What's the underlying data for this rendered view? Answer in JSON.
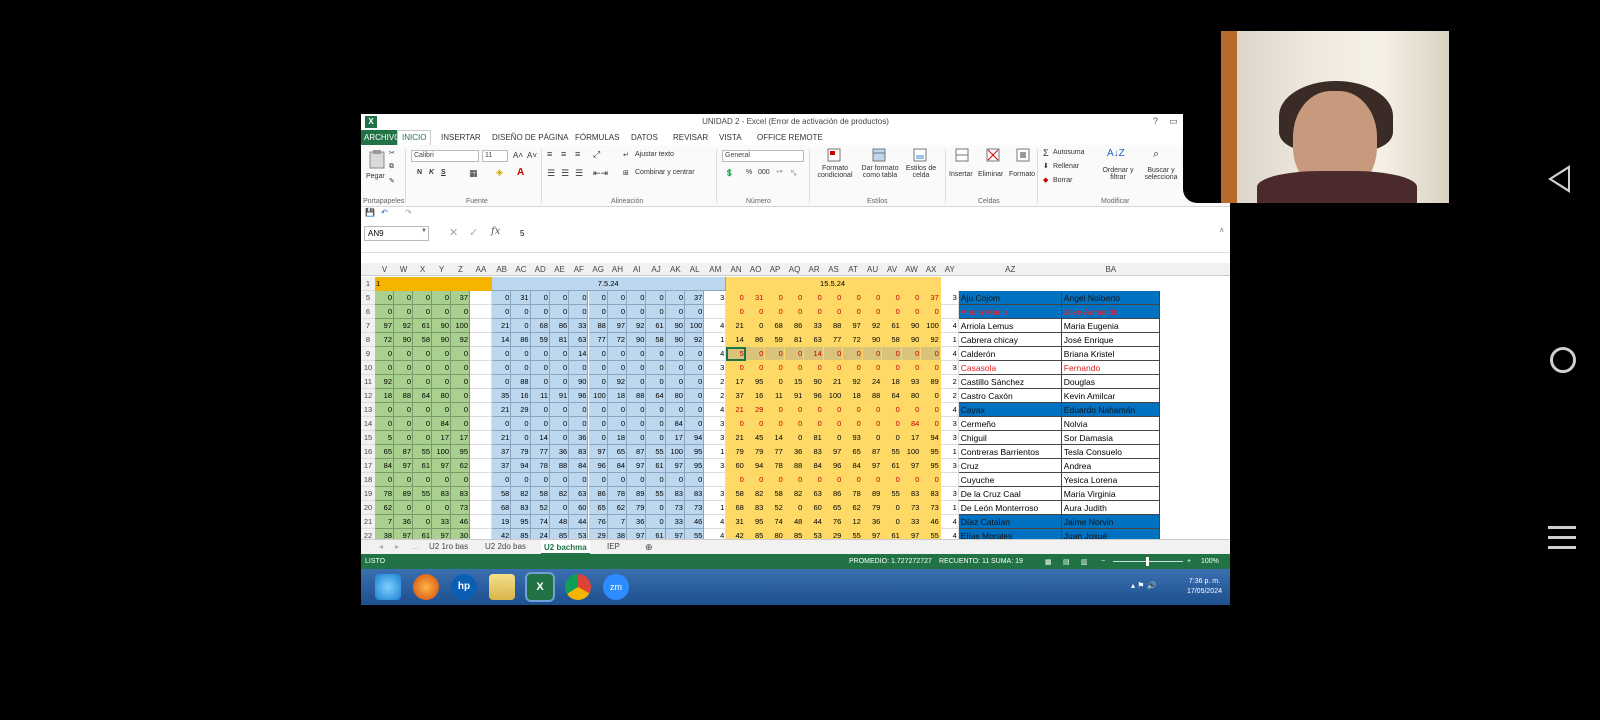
{
  "window": {
    "title": "UNIDAD 2 - Excel (Error de activación de productos)",
    "help": "?",
    "restore": "▭"
  },
  "menu": {
    "tabs": [
      "ARCHIVO",
      "INICIO",
      "INSERTAR",
      "DISEÑO DE PÁGINA",
      "FÓRMULAS",
      "DATOS",
      "REVISAR",
      "VISTA",
      "OFFICE REMOTE"
    ]
  },
  "ribbon": {
    "paste": "Pegar",
    "font_name": "Calibri",
    "font_size": "11",
    "bold": "N",
    "italic": "K",
    "underline": "S",
    "wrap_text": "Ajustar texto",
    "merge_center": "Combinar y centrar",
    "number_format": "General",
    "percent": "%",
    "thousands": "000",
    "cond_format": "Formato condicional",
    "format_table": "Dar formato como tabla",
    "cell_styles": "Estilos de celda",
    "insert": "Insertar",
    "delete": "Eliminar",
    "format": "Formato",
    "autosum": "Autosuma",
    "fill": "Rellenar",
    "clear": "Borrar",
    "sort_filter": "Ordenar y filtrar",
    "find_select": "Buscar y selecciona",
    "groups": [
      "Portapapeles",
      "Fuente",
      "Alineación",
      "Número",
      "Estilos",
      "Celdas",
      "Modificar"
    ]
  },
  "formula_bar": {
    "name_box": "AN9",
    "fx": "fx",
    "value": "5"
  },
  "columns": {
    "left": [
      "V",
      "W",
      "X",
      "Y",
      "Z",
      "AA"
    ],
    "mid": [
      "AB",
      "AC",
      "AD",
      "AE",
      "AF",
      "AG",
      "AH",
      "AI",
      "AJ",
      "AK",
      "AL",
      "AM"
    ],
    "right": [
      "AN",
      "AO",
      "AP",
      "AQ",
      "AR",
      "AS",
      "AT",
      "AU",
      "AV",
      "AW",
      "AX",
      "AY"
    ],
    "names": [
      "AZ",
      "BA"
    ]
  },
  "header_row": {
    "num": "1",
    "left": "1",
    "mid": "7.5.24",
    "right": "15.5.24"
  },
  "rows": [
    {
      "n": "5",
      "g": [
        "0",
        "0",
        "0",
        "0",
        "37"
      ],
      "b": [
        "0",
        "31",
        "0",
        "0",
        "0",
        "0",
        "0",
        "0",
        "0",
        "0",
        "37"
      ],
      "m": "3",
      "y": [
        "0",
        "31",
        "0",
        "0",
        "0",
        "0",
        "0",
        "0",
        "0",
        "0",
        "37"
      ],
      "ay": "3",
      "ln": "Aju Cojom",
      "fn": "Angel Noiberto",
      "style": "blue"
    },
    {
      "n": "6",
      "g": [
        "0",
        "0",
        "0",
        "0",
        "0"
      ],
      "b": [
        "0",
        "0",
        "0",
        "0",
        "0",
        "0",
        "0",
        "0",
        "0",
        "0",
        "0"
      ],
      "m": "",
      "y": [
        "0",
        "0",
        "0",
        "0",
        "0",
        "0",
        "0",
        "0",
        "0",
        "0",
        "0"
      ],
      "ay": "",
      "ln": "Arana Marin",
      "fn": "Jose Armando",
      "style": "blue red"
    },
    {
      "n": "7",
      "g": [
        "97",
        "92",
        "61",
        "90",
        "100"
      ],
      "b": [
        "21",
        "0",
        "68",
        "86",
        "33",
        "88",
        "97",
        "92",
        "61",
        "90",
        "100"
      ],
      "m": "4",
      "y": [
        "21",
        "0",
        "68",
        "86",
        "33",
        "88",
        "97",
        "92",
        "61",
        "90",
        "100"
      ],
      "ay": "4",
      "ln": "Arriola Lemus",
      "fn": "Maria Eugenia",
      "style": "",
      "k": true
    },
    {
      "n": "8",
      "g": [
        "72",
        "90",
        "58",
        "90",
        "92"
      ],
      "b": [
        "14",
        "86",
        "59",
        "81",
        "63",
        "77",
        "72",
        "90",
        "58",
        "90",
        "92"
      ],
      "m": "1",
      "y": [
        "14",
        "86",
        "59",
        "81",
        "63",
        "77",
        "72",
        "90",
        "58",
        "90",
        "92"
      ],
      "ay": "1",
      "ln": "Cabrera chicay",
      "fn": "José Enrique",
      "style": "",
      "k": true
    },
    {
      "n": "9",
      "g": [
        "0",
        "0",
        "0",
        "0",
        "0"
      ],
      "b": [
        "0",
        "0",
        "0",
        "0",
        "14",
        "0",
        "0",
        "0",
        "0",
        "0",
        "0"
      ],
      "m": "4",
      "y": [
        "5",
        "0",
        "0",
        "0",
        "14",
        "0",
        "0",
        "0",
        "0",
        "0",
        "0"
      ],
      "ay": "4",
      "ln": "Calderón",
      "fn": "Briana Kristel",
      "style": "",
      "sel": true
    },
    {
      "n": "10",
      "g": [
        "0",
        "0",
        "0",
        "0",
        "0"
      ],
      "b": [
        "0",
        "0",
        "0",
        "0",
        "0",
        "0",
        "0",
        "0",
        "0",
        "0",
        "0"
      ],
      "m": "3",
      "y": [
        "0",
        "0",
        "0",
        "0",
        "0",
        "0",
        "0",
        "0",
        "0",
        "0",
        "0"
      ],
      "ay": "3",
      "ln": "Casasola",
      "fn": "Fernando",
      "style": "red"
    },
    {
      "n": "11",
      "g": [
        "92",
        "0",
        "0",
        "0",
        "0"
      ],
      "b": [
        "0",
        "88",
        "0",
        "0",
        "90",
        "0",
        "92",
        "0",
        "0",
        "0",
        "0"
      ],
      "m": "2",
      "y": [
        "17",
        "95",
        "0",
        "15",
        "90",
        "21",
        "92",
        "24",
        "18",
        "93",
        "89"
      ],
      "ay": "2",
      "ln": "Castillo Sánchez",
      "fn": "Douglas",
      "style": "",
      "k": true
    },
    {
      "n": "12",
      "g": [
        "18",
        "88",
        "64",
        "80",
        "0"
      ],
      "b": [
        "35",
        "16",
        "11",
        "91",
        "96",
        "100",
        "18",
        "88",
        "64",
        "80",
        "0"
      ],
      "m": "2",
      "y": [
        "37",
        "16",
        "11",
        "91",
        "96",
        "100",
        "18",
        "88",
        "64",
        "80",
        "0"
      ],
      "ay": "2",
      "ln": "Castro Caxón",
      "fn": "Kevin Amilcar",
      "style": "",
      "k": true
    },
    {
      "n": "13",
      "g": [
        "0",
        "0",
        "0",
        "0",
        "0"
      ],
      "b": [
        "21",
        "29",
        "0",
        "0",
        "0",
        "0",
        "0",
        "0",
        "0",
        "0",
        "0"
      ],
      "m": "4",
      "y": [
        "21",
        "29",
        "0",
        "0",
        "0",
        "0",
        "0",
        "0",
        "0",
        "0",
        "0"
      ],
      "ay": "4",
      "ln": "Cayax",
      "fn": "Eduardo Nahamán",
      "style": "blue"
    },
    {
      "n": "14",
      "g": [
        "0",
        "0",
        "0",
        "84",
        "0"
      ],
      "b": [
        "0",
        "0",
        "0",
        "0",
        "0",
        "0",
        "0",
        "0",
        "0",
        "84",
        "0"
      ],
      "m": "3",
      "y": [
        "0",
        "0",
        "0",
        "0",
        "0",
        "0",
        "0",
        "0",
        "0",
        "84",
        "0"
      ],
      "ay": "3",
      "ln": "Cermeño",
      "fn": "Nolvia",
      "style": ""
    },
    {
      "n": "15",
      "g": [
        "5",
        "0",
        "0",
        "17",
        "17"
      ],
      "b": [
        "21",
        "0",
        "14",
        "0",
        "36",
        "0",
        "18",
        "0",
        "0",
        "17",
        "94"
      ],
      "m": "3",
      "y": [
        "21",
        "45",
        "14",
        "0",
        "81",
        "0",
        "93",
        "0",
        "0",
        "17",
        "94"
      ],
      "ay": "3",
      "ln": "Chiguil",
      "fn": "Sor Damasia",
      "style": "",
      "k": true
    },
    {
      "n": "16",
      "g": [
        "65",
        "87",
        "55",
        "100",
        "95"
      ],
      "b": [
        "37",
        "79",
        "77",
        "36",
        "83",
        "97",
        "65",
        "87",
        "55",
        "100",
        "95"
      ],
      "m": "1",
      "y": [
        "79",
        "79",
        "77",
        "36",
        "83",
        "97",
        "65",
        "87",
        "55",
        "100",
        "95"
      ],
      "ay": "1",
      "ln": "Contreras Barrientos",
      "fn": "Tesla Consuelo",
      "style": "",
      "k": true
    },
    {
      "n": "17",
      "g": [
        "84",
        "97",
        "61",
        "97",
        "62"
      ],
      "b": [
        "37",
        "94",
        "78",
        "88",
        "84",
        "96",
        "84",
        "97",
        "61",
        "97",
        "95"
      ],
      "m": "3",
      "y": [
        "60",
        "94",
        "78",
        "88",
        "84",
        "96",
        "84",
        "97",
        "61",
        "97",
        "95"
      ],
      "ay": "3",
      "ln": "Cruz",
      "fn": "Andrea",
      "style": "",
      "k": true
    },
    {
      "n": "18",
      "g": [
        "0",
        "0",
        "0",
        "0",
        "0"
      ],
      "b": [
        "0",
        "0",
        "0",
        "0",
        "0",
        "0",
        "0",
        "0",
        "0",
        "0",
        "0"
      ],
      "m": "",
      "y": [
        "0",
        "0",
        "0",
        "0",
        "0",
        "0",
        "0",
        "0",
        "0",
        "0",
        "0"
      ],
      "ay": "",
      "ln": "Cuyuche",
      "fn": "Yesica Lorena",
      "style": ""
    },
    {
      "n": "19",
      "g": [
        "78",
        "89",
        "55",
        "83",
        "83"
      ],
      "b": [
        "58",
        "82",
        "58",
        "82",
        "63",
        "86",
        "78",
        "89",
        "55",
        "83",
        "83"
      ],
      "m": "3",
      "y": [
        "58",
        "82",
        "58",
        "82",
        "63",
        "86",
        "78",
        "89",
        "55",
        "83",
        "83"
      ],
      "ay": "3",
      "ln": "De la Cruz Caal",
      "fn": "Maria Virginia",
      "style": "",
      "k": true
    },
    {
      "n": "20",
      "g": [
        "62",
        "0",
        "0",
        "0",
        "73"
      ],
      "b": [
        "68",
        "83",
        "52",
        "0",
        "60",
        "65",
        "62",
        "79",
        "0",
        "73",
        "73"
      ],
      "m": "1",
      "y": [
        "68",
        "83",
        "52",
        "0",
        "60",
        "65",
        "62",
        "79",
        "0",
        "73",
        "73"
      ],
      "ay": "1",
      "ln": "De León Monterroso",
      "fn": "Aura Judith",
      "style": "",
      "k": true
    },
    {
      "n": "21",
      "g": [
        "7",
        "36",
        "0",
        "33",
        "46"
      ],
      "b": [
        "19",
        "95",
        "74",
        "48",
        "44",
        "76",
        "7",
        "36",
        "0",
        "33",
        "46"
      ],
      "m": "4",
      "y": [
        "31",
        "95",
        "74",
        "48",
        "44",
        "76",
        "12",
        "36",
        "0",
        "33",
        "46"
      ],
      "ay": "4",
      "ln": "Díaz Catalan",
      "fn": "Jaime Norvin",
      "style": "blue",
      "k": true
    },
    {
      "n": "22",
      "g": [
        "38",
        "97",
        "61",
        "97",
        "30"
      ],
      "b": [
        "42",
        "85",
        "24",
        "85",
        "53",
        "29",
        "38",
        "97",
        "61",
        "97",
        "55"
      ],
      "m": "4",
      "y": [
        "42",
        "85",
        "80",
        "85",
        "53",
        "29",
        "55",
        "97",
        "61",
        "97",
        "55"
      ],
      "ay": "4",
      "ln": "Elías Morales",
      "fn": "Juan Josué",
      "style": "blue",
      "k": true
    }
  ],
  "sheet_tabs": [
    "U2 1ro bas",
    "U2 2do bas",
    "U2 bachma",
    "IEP"
  ],
  "sheet_nav": [
    "◂",
    "▸",
    "..."
  ],
  "status": {
    "mode": "LISTO",
    "avg": "PROMEDIO: 1.727272727",
    "count": "RECUENTO: 11",
    "sum": "SUMA: 19",
    "zoom": "100%"
  },
  "taskbar": {
    "time": "7:36 p. m.",
    "date": "17/05/2024",
    "icons": [
      "ie-icon",
      "firefox-icon",
      "hp-icon",
      "folder-icon",
      "excel-icon",
      "chrome-icon",
      "zoom-icon"
    ],
    "zoom_label": "zm"
  },
  "colors": {
    "excel_green": "#217346",
    "green_fill": "#a9d08e",
    "blue_fill": "#bdd7ee",
    "yellow_fill": "#ffd966",
    "name_blue": "#0070c0"
  }
}
